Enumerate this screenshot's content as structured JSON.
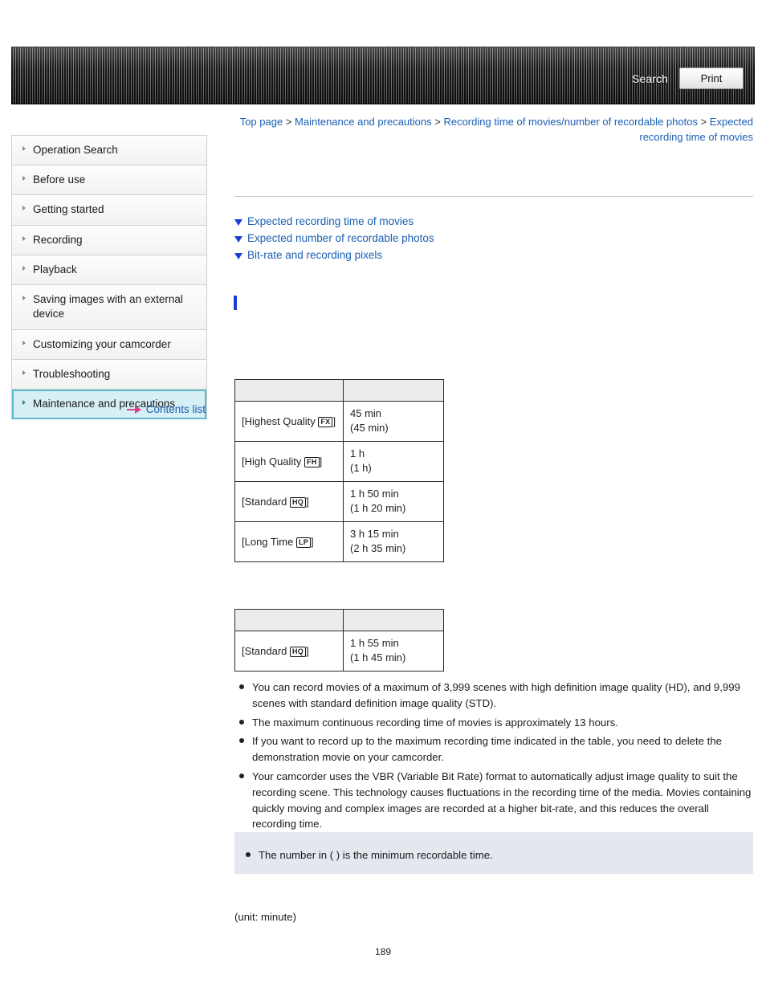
{
  "header": {
    "search_label": "Search",
    "print_label": "Print"
  },
  "breadcrumb": {
    "items": [
      {
        "label": "Top page",
        "link": true
      },
      {
        "label": "Maintenance and precautions",
        "link": true
      },
      {
        "label": "Recording time of movies/number of recordable photos",
        "link": true
      },
      {
        "label": "Expected recording time of movies",
        "link": true
      }
    ],
    "separator": ">"
  },
  "sidebar": {
    "items": [
      {
        "label": "Operation Search",
        "selected": false
      },
      {
        "label": "Before use",
        "selected": false
      },
      {
        "label": "Getting started",
        "selected": false
      },
      {
        "label": "Recording",
        "selected": false
      },
      {
        "label": "Playback",
        "selected": false
      },
      {
        "label": "Saving images with an external device",
        "selected": false
      },
      {
        "label": "Customizing your camcorder",
        "selected": false
      },
      {
        "label": "Troubleshooting",
        "selected": false
      },
      {
        "label": "Maintenance and precautions",
        "selected": true
      }
    ],
    "contents_list_label": "Contents list"
  },
  "jump_links": [
    {
      "label": "Expected recording time of movies"
    },
    {
      "label": "Expected number of recordable photos"
    },
    {
      "label": "Bit-rate and recording pixels"
    }
  ],
  "table_hd": {
    "header": [
      "",
      ""
    ],
    "rows": [
      {
        "mode": "[Highest Quality ",
        "badge": "FX",
        "mode_end": "]",
        "value_line1": "45 min",
        "value_line2": "(45 min)"
      },
      {
        "mode": "[High Quality ",
        "badge": "FH",
        "mode_end": "]",
        "value_line1": "1 h",
        "value_line2": "(1 h)"
      },
      {
        "mode": "[Standard ",
        "badge": "HQ",
        "mode_end": "]",
        "value_line1": "1 h 50 min",
        "value_line2": "(1 h 20 min)"
      },
      {
        "mode": "[Long Time ",
        "badge": "LP",
        "mode_end": "]",
        "value_line1": "3 h 15 min",
        "value_line2": "(2 h 35 min)"
      }
    ]
  },
  "table_std": {
    "header": [
      "",
      ""
    ],
    "rows": [
      {
        "mode": "[Standard ",
        "badge": "HQ",
        "mode_end": "]",
        "value_line1": "1 h 55 min",
        "value_line2": "(1 h 45 min)"
      }
    ]
  },
  "notes": [
    "You can record movies of a maximum of 3,999 scenes with high definition image quality (HD), and 9,999 scenes with standard definition image quality (STD).",
    "The maximum continuous recording time of movies is approximately 13 hours.",
    "If you want to record up to the maximum recording time indicated in the table, you need to delete the demonstration movie on your camcorder.",
    "Your camcorder uses the VBR (Variable Bit Rate) format to automatically adjust image quality to suit the recording scene. This technology causes fluctuations in the recording time of the media. Movies containing quickly moving and complex images are recorded at a higher bit-rate, and this reduces the overall recording time."
  ],
  "tip": "The number in ( ) is the minimum recordable time.",
  "unit_note": "(unit: minute)",
  "page_number": "189",
  "colors": {
    "link": "#1a5fb4",
    "marker": "#1a3fd0",
    "selected_bg": "#d6f0f5",
    "tip_bg": "#e3e8ee"
  }
}
